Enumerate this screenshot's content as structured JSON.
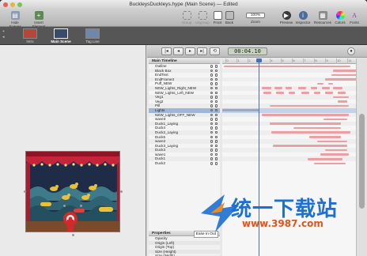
{
  "window": {
    "title": "BuckleysDuckleys.hype (Main Scene) — Edited"
  },
  "toolbar": {
    "left": [
      {
        "label": "Hide Scenes",
        "icon": "sidebar-icon"
      },
      {
        "label": "Insert Element",
        "icon": "plus-icon"
      }
    ],
    "middle": [
      {
        "label": "Group",
        "icon": "group-icon"
      },
      {
        "label": "Ungroup",
        "icon": "ungroup-icon"
      },
      {
        "label": "Front",
        "icon": "front-icon"
      },
      {
        "label": "Back",
        "icon": "back-icon"
      }
    ],
    "zoom": {
      "value": "100%",
      "label": "Zoom"
    },
    "right": [
      {
        "label": "Preview",
        "icon": "preview-icon"
      },
      {
        "label": "Inspector",
        "icon": "inspector-icon"
      },
      {
        "label": "Resources",
        "icon": "resources-icon"
      },
      {
        "label": "Colors",
        "icon": "colors-icon"
      },
      {
        "label": "Fonts",
        "icon": "fonts-icon"
      }
    ]
  },
  "scenes": [
    {
      "label": "Intro"
    },
    {
      "label": "Main Scene",
      "active": true
    },
    {
      "label": "Tag Line"
    }
  ],
  "timeline": {
    "timecode": "00:04.10",
    "header": "Main Timeline",
    "layers": [
      "Outline",
      "Black Box",
      "EndText",
      "EndFrame3",
      "Puff_NEW",
      "NEW_Lights_Right_NEW",
      "NEW_Lights_Left_NEW",
      "Veg1",
      "Veg2",
      "Pill",
      "Lights",
      "NEW_Lights_OFF_NEW",
      "wave3",
      "Duck1_Laying",
      "Duck4",
      "Duck2_Laying",
      "Duck5",
      "wave2",
      "Duck3_Laying",
      "Duck3",
      "wave1",
      "Duck1",
      "Duck2"
    ],
    "selected_index": 10,
    "properties_header": "Properties",
    "properties_dropdown": "Ease In Out",
    "properties": [
      "Opacity",
      "Origin (Left)",
      "Origin (Top)",
      "Size (Height)",
      "Size (Width)"
    ],
    "ruler_labels": [
      "0",
      "1",
      "2",
      "3",
      "4",
      "5",
      "6",
      "7",
      "8",
      "9",
      "10",
      "11"
    ]
  },
  "watermark": {
    "line1": "统一下载站",
    "line2": "www.3987.com"
  },
  "colors": {
    "accent": "#4a6fb0",
    "keyframe_bar": "#e8a0a5",
    "selection": "#9fb7d6"
  }
}
